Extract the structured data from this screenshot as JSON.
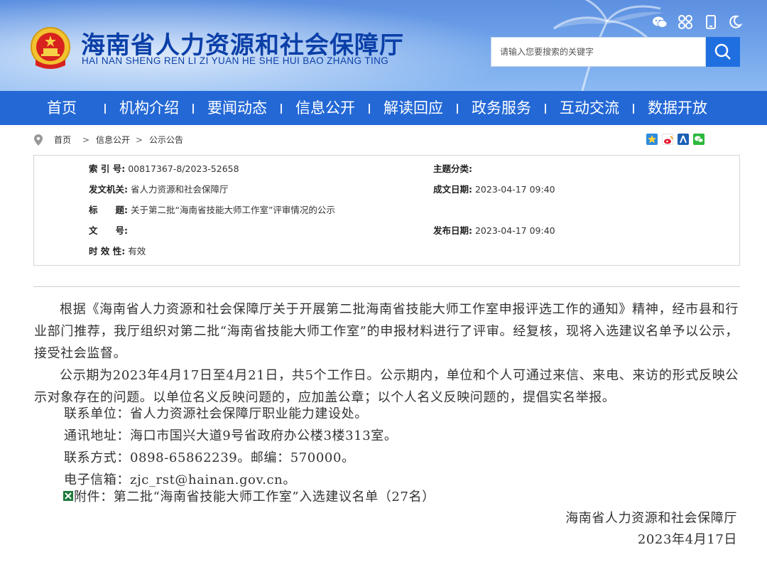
{
  "header": {
    "title": "海南省人力资源和社会保障厅",
    "subtitle": "HAI NAN SHENG REN LI ZI YUAN HE SHE HUI BAO ZHANG TING",
    "emblem_icon": "national-emblem-icon",
    "top_icons": [
      "wechat-icon",
      "app-grid-icon",
      "mobile-icon",
      "moon-icon"
    ]
  },
  "search": {
    "placeholder": "请输入您要搜索的关键字",
    "icon": "search-icon"
  },
  "nav": {
    "items": [
      "首页",
      "机构介绍",
      "要闻动态",
      "信息公开",
      "解读回应",
      "政务服务",
      "互动交流",
      "数据开放"
    ]
  },
  "breadcrumb": {
    "items": [
      "首页",
      "信息公开",
      "公示公告"
    ],
    "separator": ">",
    "icon": "location-pin-icon"
  },
  "share_icons": [
    "qzone-icon",
    "weibo-icon",
    "renren-icon",
    "wechat-share-icon"
  ],
  "meta": {
    "index_label": "索 引 号:",
    "index_value": "00817367-8/2023-52658",
    "topic_label": "主题分类:",
    "topic_value": "",
    "issuer_label": "发文机关:",
    "issuer_value": "省人力资源和社会保障厅",
    "created_label": "成文日期:",
    "created_value": "2023-04-17 09:40",
    "title_label": "标　　题:",
    "title_value": "关于第二批“海南省技能大师工作室”评审情况的公示",
    "docno_label": "文　　号:",
    "docno_value": "",
    "published_label": "发布日期:",
    "published_value": "2023-04-17 09:40",
    "validity_label": "时 效 性:",
    "validity_value": "有效"
  },
  "article": {
    "para1": "根据《海南省人力资源和社会保障厅关于开展第二批海南省技能大师工作室申报评选工作的通知》精神，经市县和行业部门推荐，我厅组织对第二批“海南省技能大师工作室”的申报材料进行了评审。经复核，现将入选建议名单予以公示，接受社会监督。",
    "para2": "公示期为2023年4月17日至4月21日，共5个工作日。公示期内，单位和个人可通过来信、来电、来访的形式反映公示对象存在的问题。以单位名义反映问题的，应加盖公章；以个人名义反映问题的，提倡实名举报。",
    "contact_unit": "联系单位：省人力资源社会保障厅职业能力建设处。",
    "address": "通讯地址：海口市国兴大道9号省政府办公楼3楼313室。",
    "phone": "联系方式：0898-65862239。邮编：570000。",
    "email": "电子信箱：zjc_rst@hainan.gov.cn。",
    "attachment": "附件：第二批“海南省技能大师工作室”入选建议名单（27名）",
    "attachment_icon": "excel-file-icon",
    "signature": "海南省人力资源和社会保障厅",
    "date": "2023年4月17日"
  }
}
